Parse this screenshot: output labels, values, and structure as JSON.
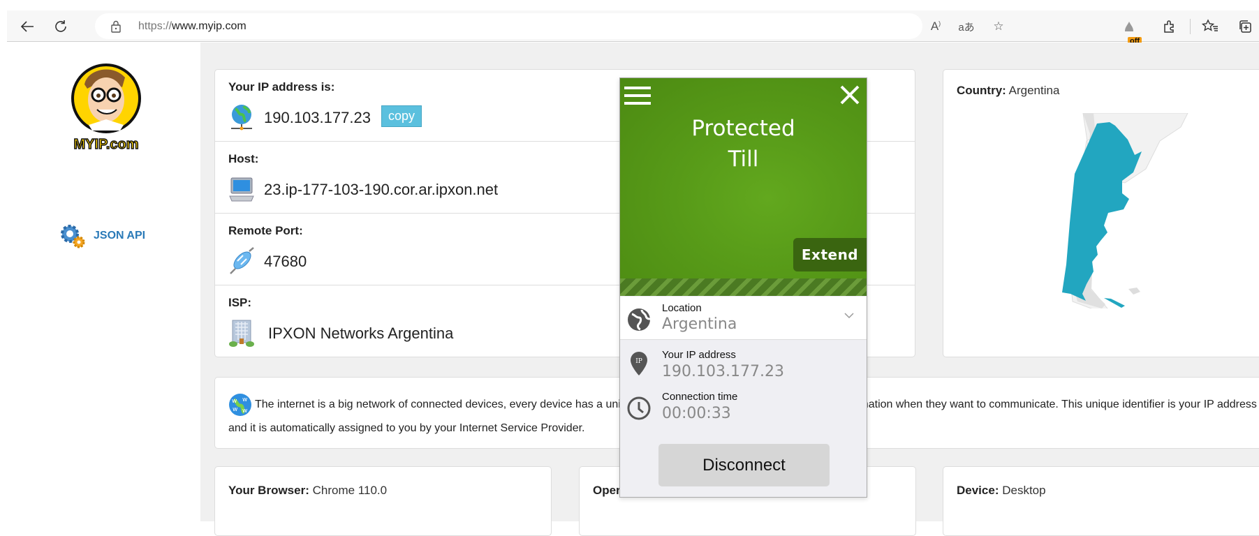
{
  "browser": {
    "url_scheme": "https://",
    "url_host": "www.myip.com",
    "extension_badge": "off",
    "icons": [
      "back-icon",
      "refresh-icon",
      "lock-icon",
      "read-aloud-icon",
      "translate-icon",
      "add-favorite-icon",
      "extension-off-icon",
      "extensions-icon",
      "favorites-icon",
      "collections-icon"
    ]
  },
  "sidebar": {
    "logo_text": "MYIP.com",
    "json_api_label": "JSON API"
  },
  "ip_card": {
    "rows": [
      {
        "label": "Your IP address is:",
        "value": "190.103.177.23",
        "icon": "globe-network-icon"
      },
      {
        "label": "Host:",
        "value": "23.ip-177-103-190.cor.ar.ipxon.net",
        "icon": "computer-icon"
      },
      {
        "label": "Remote Port:",
        "value": "47680",
        "icon": "plug-icon"
      },
      {
        "label": "ISP:",
        "value": "IPXON Networks Argentina",
        "icon": "building-icon"
      }
    ],
    "copy_label": "copy"
  },
  "country_card": {
    "label": "Country:",
    "value": "Argentina",
    "highlight_color": "#22a6c0"
  },
  "description": {
    "text": "The internet is a big network of connected devices, every device has a unique address that other devices use to send information when they want to communicate. This unique identifier is your IP address and it is automatically assigned to you by your Internet Service Provider."
  },
  "bottom_cards": [
    {
      "label": "Your Browser:",
      "value": "Chrome 110.0"
    },
    {
      "label": "Operating System:",
      "value": ""
    },
    {
      "label": "Device:",
      "value": "Desktop"
    }
  ],
  "vpn_popup": {
    "title_line1": "Protected",
    "title_line2": "Till",
    "extend_label": "Extend",
    "location_label": "Location",
    "location_value": "Argentina",
    "ip_label": "Your IP address",
    "ip_value": "190.103.177.23",
    "time_label": "Connection time",
    "time_value": "00:00:33",
    "disconnect_label": "Disconnect",
    "accent_color": "#579a18"
  }
}
